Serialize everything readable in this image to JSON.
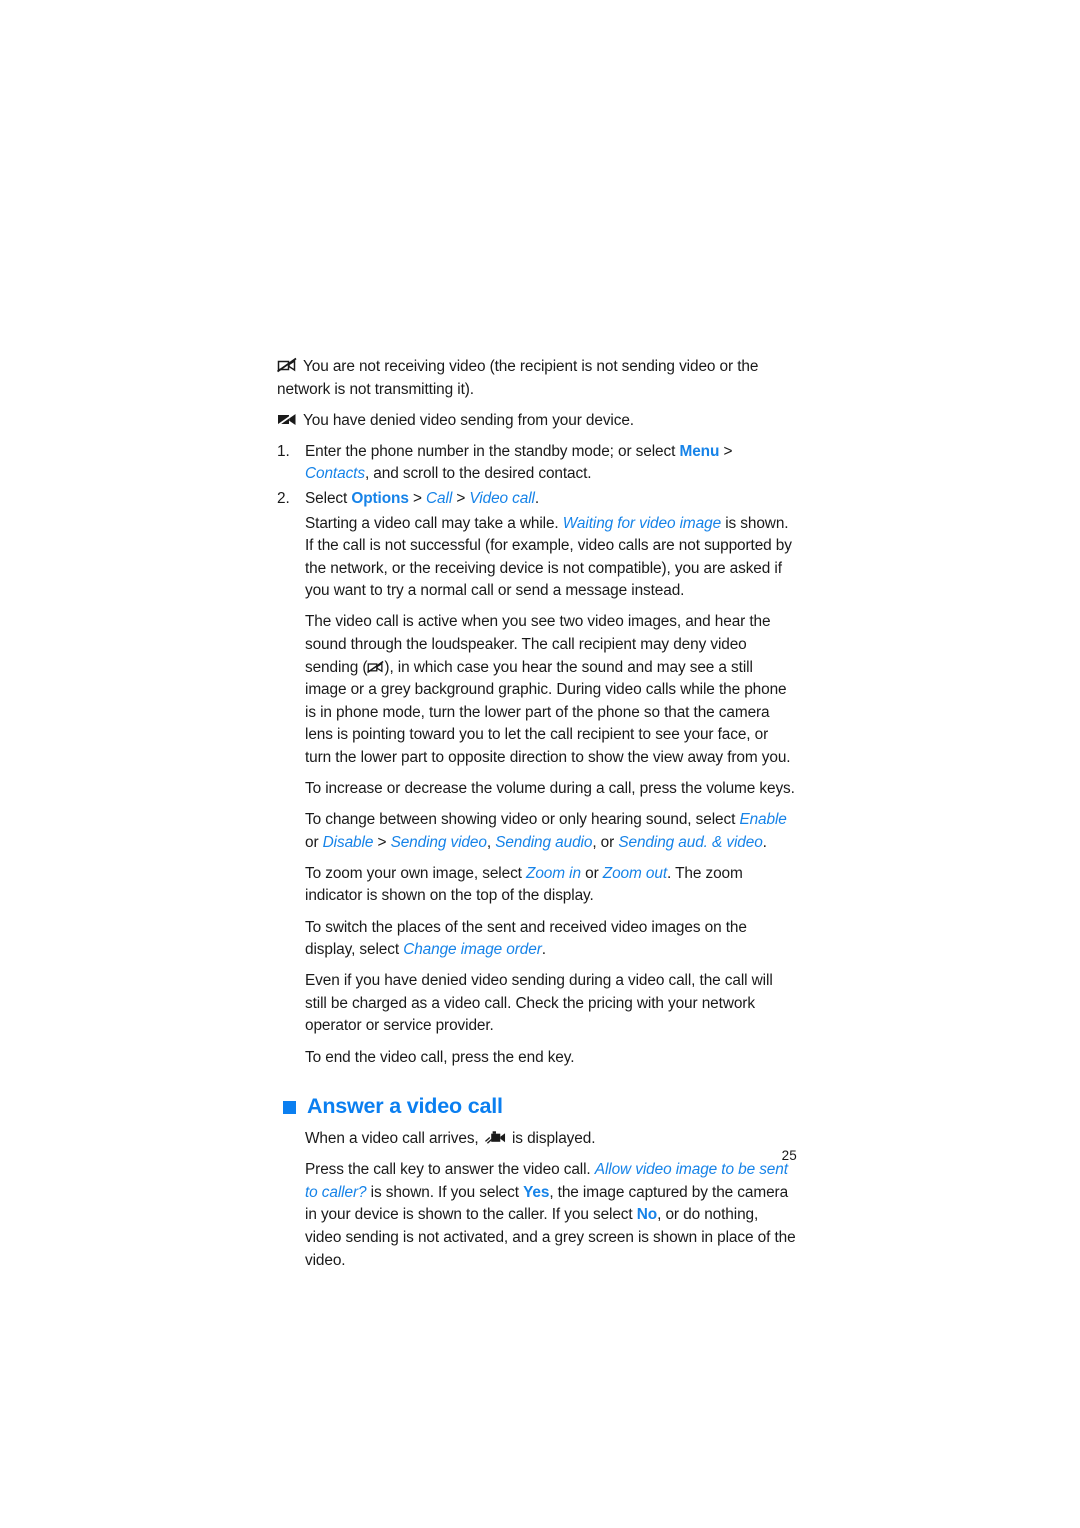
{
  "document": {
    "page_number": "25",
    "accent_color": "#1683e8",
    "heading_color": "#0b7ff0",
    "body_color": "#1a1a1a"
  },
  "notes": [
    {
      "icon": "no-video-receiving-icon",
      "text": "You are not receiving video (the recipient is not sending video or the network is not transmitting it)."
    },
    {
      "icon": "video-sending-denied-icon",
      "text": "You have denied video sending from your device."
    }
  ],
  "steps": [
    {
      "number": "1.",
      "parts": [
        {
          "t": "Enter the phone number in the standby mode; or select ",
          "s": "plain"
        },
        {
          "t": "Menu",
          "s": "ui"
        },
        {
          "t": " > ",
          "s": "plain"
        },
        {
          "t": "Contacts",
          "s": "it"
        },
        {
          "t": ", and scroll to the desired contact.",
          "s": "plain"
        }
      ]
    },
    {
      "number": "2.",
      "parts": [
        {
          "t": "Select ",
          "s": "plain"
        },
        {
          "t": "Options",
          "s": "ui"
        },
        {
          "t": " > ",
          "s": "plain"
        },
        {
          "t": "Call",
          "s": "it"
        },
        {
          "t": " > ",
          "s": "plain"
        },
        {
          "t": "Video call",
          "s": "it"
        },
        {
          "t": ".",
          "s": "plain"
        }
      ]
    }
  ],
  "paragraphs": [
    {
      "name": "starting-video-call-paragraph",
      "parts": [
        {
          "t": "Starting a video call may take a while. ",
          "s": "plain"
        },
        {
          "t": "Waiting for video image",
          "s": "it"
        },
        {
          "t": " is shown. If the call is not successful (for example, video calls are not supported by the network, or the receiving device is not compatible), you are asked if you want to try a normal call or send a message instead.",
          "s": "plain"
        }
      ]
    },
    {
      "name": "active-video-call-paragraph",
      "parts": [
        {
          "t": "The video call is active when you see two video images, and hear the sound through the loudspeaker. The call recipient may deny video sending (",
          "s": "plain"
        },
        {
          "t": "",
          "s": "icon",
          "icon": "no-video-sending-icon"
        },
        {
          "t": "), in which case you hear the sound and may see a still image or a grey background graphic. During video calls while the phone is in phone mode, turn the lower part of the phone so that the camera lens is pointing toward you to let the call recipient to see your face, or turn the lower part to opposite direction to show the view away from you.",
          "s": "plain"
        }
      ]
    },
    {
      "name": "volume-paragraph",
      "parts": [
        {
          "t": "To increase or decrease the volume during a call, press the volume keys.",
          "s": "plain"
        }
      ]
    },
    {
      "name": "enable-disable-paragraph",
      "parts": [
        {
          "t": "To change between showing video or only hearing sound, select ",
          "s": "plain"
        },
        {
          "t": "Enable",
          "s": "it"
        },
        {
          "t": " or ",
          "s": "plain"
        },
        {
          "t": "Disable",
          "s": "it"
        },
        {
          "t": " > ",
          "s": "plain"
        },
        {
          "t": "Sending video",
          "s": "it"
        },
        {
          "t": ", ",
          "s": "plain"
        },
        {
          "t": "Sending audio",
          "s": "it"
        },
        {
          "t": ", or ",
          "s": "plain"
        },
        {
          "t": "Sending aud. & video",
          "s": "it"
        },
        {
          "t": ".",
          "s": "plain"
        }
      ]
    },
    {
      "name": "zoom-paragraph",
      "parts": [
        {
          "t": "To zoom your own image, select ",
          "s": "plain"
        },
        {
          "t": "Zoom in",
          "s": "it"
        },
        {
          "t": " or ",
          "s": "plain"
        },
        {
          "t": "Zoom out",
          "s": "it"
        },
        {
          "t": ". The zoom indicator is shown on the top of the display.",
          "s": "plain"
        }
      ]
    },
    {
      "name": "change-image-order-paragraph",
      "parts": [
        {
          "t": "To switch the places of the sent and received video images on the display, select ",
          "s": "plain"
        },
        {
          "t": "Change image order",
          "s": "it"
        },
        {
          "t": ".",
          "s": "plain"
        }
      ]
    },
    {
      "name": "charging-paragraph",
      "parts": [
        {
          "t": "Even if you have denied video sending during a video call, the call will still be charged as a video call. Check the pricing with your network operator or service provider.",
          "s": "plain"
        }
      ]
    },
    {
      "name": "end-call-paragraph",
      "parts": [
        {
          "t": "To end the video call, press the end key.",
          "s": "plain"
        }
      ]
    }
  ],
  "section": {
    "heading": "Answer a video call",
    "bullet": "square-bullet-icon",
    "paragraphs": [
      {
        "name": "incoming-video-call-paragraph",
        "parts": [
          {
            "t": "When a video call arrives, ",
            "s": "plain"
          },
          {
            "t": "",
            "s": "icon",
            "icon": "incoming-video-call-icon"
          },
          {
            "t": " is displayed.",
            "s": "plain"
          }
        ]
      },
      {
        "name": "answer-video-call-paragraph",
        "parts": [
          {
            "t": "Press the call key to answer the video call. ",
            "s": "plain"
          },
          {
            "t": "Allow video image to be sent to caller?",
            "s": "it"
          },
          {
            "t": " is shown. If you select ",
            "s": "plain"
          },
          {
            "t": "Yes",
            "s": "ui"
          },
          {
            "t": ", the image captured by the camera in your device is shown to the caller. If you select ",
            "s": "plain"
          },
          {
            "t": "No",
            "s": "ui"
          },
          {
            "t": ", or do nothing, video sending is not activated, and a grey screen is shown in place of the video.",
            "s": "plain"
          }
        ]
      }
    ]
  }
}
